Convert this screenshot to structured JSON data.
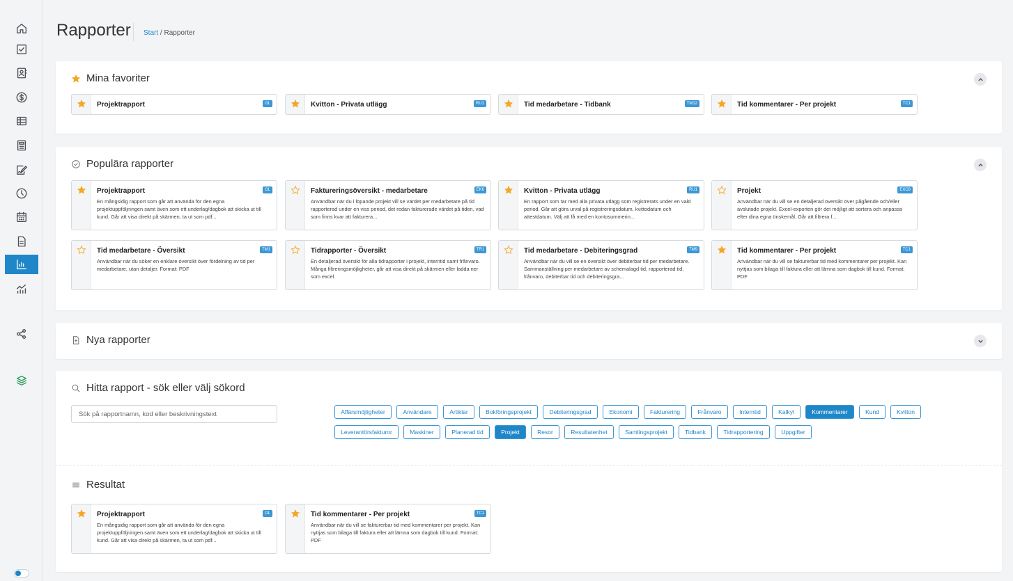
{
  "header": {
    "title": "Rapporter",
    "breadcrumb_start": "Start",
    "breadcrumb_sep": " / ",
    "breadcrumb_current": "Rapporter"
  },
  "sidebar": {
    "items": [
      {
        "icon": "home-icon"
      },
      {
        "icon": "checkbox-icon"
      },
      {
        "icon": "contact-card-icon"
      },
      {
        "icon": "dollar-icon"
      },
      {
        "icon": "table-icon"
      },
      {
        "icon": "calculator-icon"
      },
      {
        "icon": "signature-icon"
      },
      {
        "icon": "clock-icon"
      },
      {
        "icon": "calendar-icon"
      },
      {
        "icon": "document-icon"
      },
      {
        "icon": "bar-chart-icon",
        "active": true
      },
      {
        "icon": "analytics-icon"
      },
      {
        "icon": "share-icon"
      },
      {
        "icon": "layers-icon"
      }
    ]
  },
  "favorites": {
    "title": "Mina favoriter",
    "cards": [
      {
        "name": "Projektrapport",
        "code": "OL",
        "starred": true
      },
      {
        "name": "Kvitton - Privata utlägg",
        "code": "RU1",
        "starred": true
      },
      {
        "name": "Tid medarbetare - Tidbank",
        "code": "TM12",
        "starred": true
      },
      {
        "name": "Tid kommentarer - Per projekt",
        "code": "TC1",
        "starred": true
      }
    ]
  },
  "popular": {
    "title": "Populära rapporter",
    "cards": [
      {
        "name": "Projektrapport",
        "code": "OL",
        "starred": true,
        "desc": "En mångsidig rapport som går att använda för den egna projektuppföljningen samt även som ett underlag/dagbok att skicka ut till kund. Går att visa direkt på skärmen, ta ut som pdf..."
      },
      {
        "name": "Faktureringsöversikt - medarbetare",
        "code": "EK6",
        "starred": false,
        "desc": "Användbar när du i löpande projekt vill se värdet per medarbetare på tid rapporterad under en viss period, det redan fakturerade värdet på tiden, vad som finns kvar att fakturera..."
      },
      {
        "name": "Kvitton - Privata utlägg",
        "code": "RU1",
        "starred": true,
        "desc": "En rapport som tar med alla privata utlägg som registrerats under en vald period. Går att göra urval på registreringsdatum, kvittodatum och attestdatum. Välj att få med en kontosummerin..."
      },
      {
        "name": "Projekt",
        "code": "EXC8",
        "starred": false,
        "desc": "Användbar när du vill se en detaljerad översikt över pågående och/eller avslutade projekt. Excel-exporten gör det möjligt att sortera och anpassa efter dina egna önskemål. Går att filtrera f..."
      },
      {
        "name": "Tid medarbetare - Översikt",
        "code": "TM1",
        "starred": false,
        "desc": "Användbar när du söker en enklare översikt över fördelning av tid per medarbetare, utan detaljer. Format: PDF"
      },
      {
        "name": "Tidrapporter - Översikt",
        "code": "TR1",
        "starred": false,
        "desc": "En detaljerad översikt för alla tidrapporter i projekt, interntid samt frånvaro. Många filtreringsmöjligheter, går att visa direkt på skärmen eller ladda ner som excel."
      },
      {
        "name": "Tid medarbetare - Debiteringsgrad",
        "code": "TM9",
        "starred": false,
        "desc": "Användbar när du vill se en översikt över debiterbar tid per medarbetare. Sammanställning per medarbetare av schemalagd tid, rapporterad tid, frånvaro, debiterbar tid och debiteringsgra..."
      },
      {
        "name": "Tid kommentarer - Per projekt",
        "code": "TC1",
        "starred": true,
        "desc": "Användbar när du vill se fakturerbar tid med kommentarer per projekt. Kan nyttjas som bilaga till faktura eller att lämna som dagbok till kund. Format: PDF"
      }
    ]
  },
  "new_reports": {
    "title": "Nya rapporter"
  },
  "search": {
    "title": "Hitta rapport - sök eller välj sökord",
    "placeholder": "Sök på rapportnamn, kod eller beskrivningstext",
    "tags": [
      {
        "label": "Affärsmöjligheter",
        "selected": false
      },
      {
        "label": "Användare",
        "selected": false
      },
      {
        "label": "Artiklar",
        "selected": false
      },
      {
        "label": "Bokföringsprojekt",
        "selected": false
      },
      {
        "label": "Debiteringsgrad",
        "selected": false
      },
      {
        "label": "Ekonomi",
        "selected": false
      },
      {
        "label": "Fakturering",
        "selected": false
      },
      {
        "label": "Frånvaro",
        "selected": false
      },
      {
        "label": "Interntid",
        "selected": false
      },
      {
        "label": "Kalkyl",
        "selected": false
      },
      {
        "label": "Kommentarer",
        "selected": true
      },
      {
        "label": "Kund",
        "selected": false
      },
      {
        "label": "Kvitton",
        "selected": false
      },
      {
        "label": "Leverantörsfakturor",
        "selected": false
      },
      {
        "label": "Maskiner",
        "selected": false
      },
      {
        "label": "Planerad tid",
        "selected": false
      },
      {
        "label": "Projekt",
        "selected": true
      },
      {
        "label": "Resor",
        "selected": false
      },
      {
        "label": "Resultatenhet",
        "selected": false
      },
      {
        "label": "Samlingsprojekt",
        "selected": false
      },
      {
        "label": "Tidbank",
        "selected": false
      },
      {
        "label": "Tidrapportering",
        "selected": false
      },
      {
        "label": "Uppgifter",
        "selected": false
      }
    ]
  },
  "results": {
    "title": "Resultat",
    "cards": [
      {
        "name": "Projektrapport",
        "code": "OL",
        "starred": true,
        "desc": "En mångsidig rapport som går att använda för den egna projektuppföljningen samt även som ett underlag/dagbok att skicka ut till kund. Går att visa direkt på skärmen, ta ut som pdf..."
      },
      {
        "name": "Tid kommentarer - Per projekt",
        "code": "TC1",
        "starred": true,
        "desc": "Användbar när du vill se fakturerbar tid med kommentarer per projekt. Kan nyttjas som bilaga till faktura eller att lämna som dagbok till kund. Format: PDF"
      }
    ]
  },
  "colors": {
    "accent": "#1f87c8",
    "star_filled": "#f5a623",
    "star_empty": "#f5a623",
    "code_badge": "#3b97d6"
  }
}
